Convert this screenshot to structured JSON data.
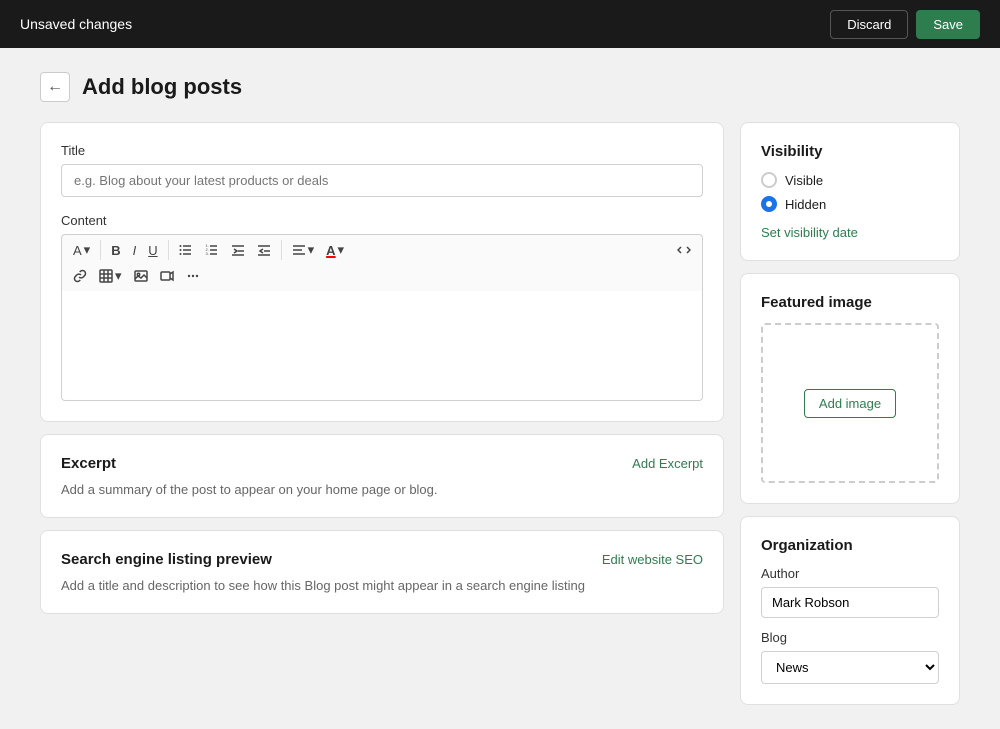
{
  "topbar": {
    "title": "Unsaved changes",
    "discard_label": "Discard",
    "save_label": "Save"
  },
  "page": {
    "title": "Add blog posts"
  },
  "main": {
    "title_section": {
      "label": "Title",
      "placeholder": "e.g. Blog about your latest products or deals"
    },
    "content_section": {
      "label": "Content"
    },
    "excerpt_section": {
      "title": "Excerpt",
      "add_label": "Add Excerpt",
      "description": "Add a summary of the post to appear on your home page or blog."
    },
    "seo_section": {
      "title": "Search engine listing preview",
      "edit_label": "Edit website SEO",
      "description": "Add a title and description to see how this Blog post might appear in a search engine listing"
    }
  },
  "sidebar": {
    "visibility": {
      "title": "Visibility",
      "options": [
        "Visible",
        "Hidden"
      ],
      "selected": "Hidden",
      "set_date_label": "Set visibility date"
    },
    "featured_image": {
      "title": "Featured image",
      "add_label": "Add image"
    },
    "organization": {
      "title": "Organization",
      "author_label": "Author",
      "author_value": "Mark Robson",
      "blog_label": "Blog",
      "blog_options": [
        "News"
      ],
      "blog_selected": "News"
    }
  },
  "toolbar": {
    "font_label": "A",
    "bold_label": "B",
    "italic_label": "I",
    "underline_label": "U"
  }
}
